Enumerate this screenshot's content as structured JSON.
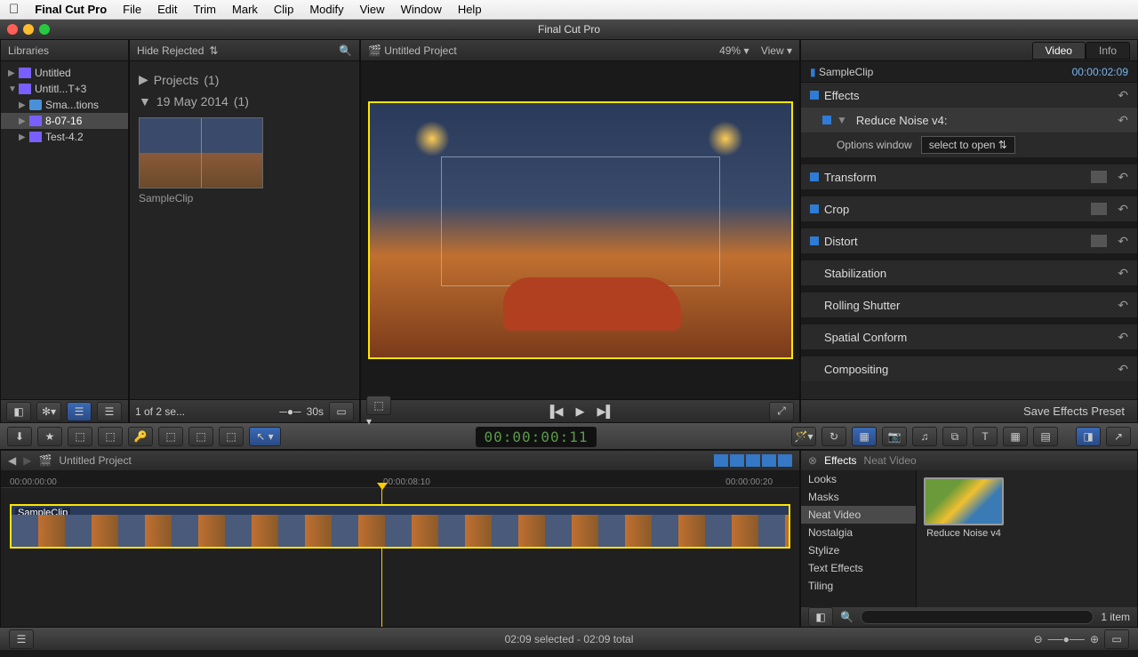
{
  "menubar": {
    "app_name": "Final Cut Pro",
    "items": [
      "File",
      "Edit",
      "Trim",
      "Mark",
      "Clip",
      "Modify",
      "View",
      "Window",
      "Help"
    ]
  },
  "window_title": "Final Cut Pro",
  "libraries": {
    "header": "Libraries",
    "filter_label": "Hide Rejected",
    "tree": [
      {
        "label": "Untitled",
        "icon": "star",
        "level": 0
      },
      {
        "label": "Untitl...T+3",
        "icon": "star",
        "level": 0
      },
      {
        "label": "Sma...tions",
        "icon": "folder",
        "level": 1
      },
      {
        "label": "8-07-16",
        "icon": "star",
        "level": 1,
        "selected": true
      },
      {
        "label": "Test-4.2",
        "icon": "star",
        "level": 1
      }
    ]
  },
  "browser": {
    "projects_label": "Projects",
    "projects_count": "(1)",
    "date_label": "19 May 2014",
    "date_count": "(1)",
    "clip_name": "SampleClip",
    "footer_status": "1 of 2 se...",
    "footer_scale": "30s"
  },
  "viewer": {
    "project_name": "Untitled Project",
    "zoom": "49%",
    "view_menu": "View"
  },
  "inspector": {
    "tabs": {
      "video": "Video",
      "info": "Info"
    },
    "clip_name": "SampleClip",
    "timecode": "00:00:02:09",
    "sections": {
      "effects": "Effects",
      "reduce_noise": "Reduce Noise v4:",
      "options_label": "Options window",
      "options_select": "select to open",
      "transform": "Transform",
      "crop": "Crop",
      "distort": "Distort",
      "stabilization": "Stabilization",
      "rolling_shutter": "Rolling Shutter",
      "spatial_conform": "Spatial Conform",
      "compositing": "Compositing"
    },
    "save_preset": "Save Effects Preset"
  },
  "timecode_display": "00:00:00:11",
  "timeline": {
    "project_name": "Untitled Project",
    "tc_start": "00:00:00:00",
    "tc_mid": "00:00:08:10",
    "tc_end": "00:00:00:20",
    "clip_label": "SampleClip"
  },
  "effects_browser": {
    "title": "Effects",
    "subtitle": "Neat Video",
    "categories": [
      "Looks",
      "Masks",
      "Neat Video",
      "Nostalgia",
      "Stylize",
      "Text Effects",
      "Tiling"
    ],
    "selected_category": "Neat Video",
    "item_name": "Reduce Noise v4",
    "item_count": "1 item"
  },
  "status_bar": {
    "selection": "02:09 selected - 02:09 total"
  }
}
